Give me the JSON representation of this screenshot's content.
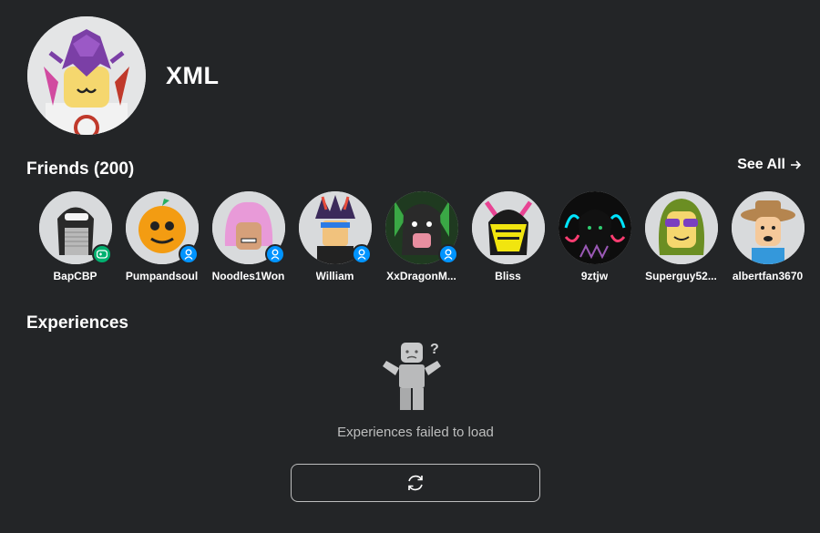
{
  "profile": {
    "display_name": "XML",
    "avatar_icon": "user-avatar-purple-helmet"
  },
  "friends": {
    "title": "Friends (200)",
    "see_all_label": "See All",
    "see_all_icon": "arrow-right-icon",
    "items": [
      {
        "name": "BapCBP",
        "badge": "game"
      },
      {
        "name": "Pumpandsoul",
        "badge": "online"
      },
      {
        "name": "Noodles1Won",
        "badge": "online"
      },
      {
        "name": "William",
        "badge": "online"
      },
      {
        "name": "XxDragonM...",
        "badge": "online"
      },
      {
        "name": "Bliss",
        "badge": ""
      },
      {
        "name": "9ztjw",
        "badge": ""
      },
      {
        "name": "Superguy52...",
        "badge": ""
      },
      {
        "name": "albertfan3670",
        "badge": ""
      }
    ]
  },
  "experiences": {
    "title": "Experiences",
    "error_text": "Experiences failed to load",
    "reload_icon": "refresh-icon"
  },
  "colors": {
    "background": "#232527",
    "online_badge": "#0094ff",
    "game_badge": "#00b06f",
    "muted_text": "#bdbebe"
  }
}
